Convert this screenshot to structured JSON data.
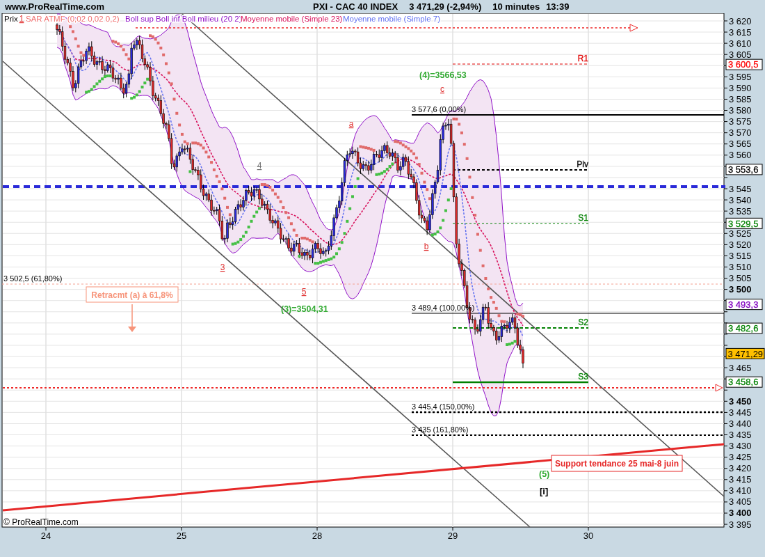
{
  "header": {
    "site": "www.ProRealTime.com",
    "instrument": "PXI - CAC 40 INDEX",
    "quote": "3 471,29 (-2,94%)",
    "interval": "10 minutes",
    "time": "13:39"
  },
  "legend": [
    {
      "label": "Prix",
      "color": "#000000"
    },
    {
      "label": "SAR ATMF (0,02 0,02 0,2)",
      "color": "#f07070"
    },
    {
      "label": "Boll sup Boll inf Boll milieu (20 2)",
      "color": "#9010c8"
    },
    {
      "label": "Moyenne mobile (Simple 23)",
      "color": "#d8105a"
    },
    {
      "label": "Moyenne mobile (Simple 7)",
      "color": "#6070f0"
    }
  ],
  "wave_labels": [
    {
      "label": "1",
      "color": "#e03030"
    },
    {
      "label": "4",
      "color": "#707070"
    },
    {
      "label": "3",
      "color": "#e03030"
    },
    {
      "label": "5",
      "color": "#e03030"
    },
    {
      "label": "a",
      "color": "#e03030"
    },
    {
      "label": "b",
      "color": "#e03030"
    },
    {
      "label": "c",
      "color": "#e03030"
    }
  ],
  "elliott_labels": [
    {
      "label": "(4)=3566,53",
      "kind": "target"
    },
    {
      "label": "(3)=3504,31",
      "kind": "target"
    },
    {
      "label": "(5)",
      "kind": "target"
    },
    {
      "label": "[i]",
      "kind": "degree"
    }
  ],
  "pivots": [
    {
      "label": "R1",
      "color": "#e00000"
    },
    {
      "label": "Piv",
      "color": "#000000"
    },
    {
      "label": "S1",
      "color": "#008000"
    },
    {
      "label": "S2",
      "color": "#008000"
    },
    {
      "label": "S3",
      "color": "#008000"
    }
  ],
  "fib_levels": [
    "3 577,6 (0,00%)",
    "3 489,4 (100,00%)",
    "3 445,4 (150,00%)",
    "3 435 (161,80%)",
    "3 502,5 (61,80%)"
  ],
  "callouts": [
    {
      "label": "Retracmt (a) à 61,8%",
      "kind": "retracement"
    },
    {
      "label": "Support tendance 25 mai-8 juin",
      "kind": "support"
    }
  ],
  "price_axis": {
    "ticks": [
      {
        "label": "3 620",
        "major": false
      },
      {
        "label": "3 615",
        "major": false
      },
      {
        "label": "3 610",
        "major": false
      },
      {
        "label": "3 605",
        "major": false
      },
      {
        "label": "3 595",
        "major": false
      },
      {
        "label": "3 590",
        "major": false
      },
      {
        "label": "3 585",
        "major": false
      },
      {
        "label": "3 580",
        "major": false
      },
      {
        "label": "3 575",
        "major": false
      },
      {
        "label": "3 570",
        "major": false
      },
      {
        "label": "3 565",
        "major": false
      },
      {
        "label": "3 560",
        "major": false
      },
      {
        "label": "3 545",
        "major": false
      },
      {
        "label": "3 540",
        "major": false
      },
      {
        "label": "3 535",
        "major": false
      },
      {
        "label": "3 525",
        "major": false
      },
      {
        "label": "3 520",
        "major": false
      },
      {
        "label": "3 515",
        "major": false
      },
      {
        "label": "3 510",
        "major": false
      },
      {
        "label": "3 505",
        "major": false
      },
      {
        "label": "3 500",
        "major": true
      },
      {
        "label": "3 465",
        "major": false
      },
      {
        "label": "3 450",
        "major": true
      },
      {
        "label": "3 445",
        "major": false
      },
      {
        "label": "3 440",
        "major": false
      },
      {
        "label": "3 435",
        "major": false
      },
      {
        "label": "3 430",
        "major": false
      },
      {
        "label": "3 425",
        "major": false
      },
      {
        "label": "3 420",
        "major": false
      },
      {
        "label": "3 415",
        "major": false
      },
      {
        "label": "3 410",
        "major": false
      },
      {
        "label": "3 405",
        "major": false
      },
      {
        "label": "3 400",
        "major": true
      },
      {
        "label": "3 395",
        "major": false
      }
    ],
    "markers": [
      {
        "label": "3 600,5",
        "color": "#ff0000",
        "kind": "level"
      },
      {
        "label": "3 553,6",
        "color": "#000000",
        "kind": "level"
      },
      {
        "label": "3 529,5",
        "color": "#008000",
        "kind": "level"
      },
      {
        "label": "3 493,3",
        "color": "#8000c0",
        "kind": "level"
      },
      {
        "label": "3 482,6",
        "color": "#008000",
        "kind": "level"
      },
      {
        "label": "3 471,29",
        "color": "#ffc000",
        "kind": "last"
      },
      {
        "label": "3 458,6",
        "color": "#008000",
        "kind": "level"
      }
    ]
  },
  "date_axis": [
    "24",
    "25",
    "28",
    "29",
    "30"
  ],
  "copyright": "© ProRealTime.com"
}
